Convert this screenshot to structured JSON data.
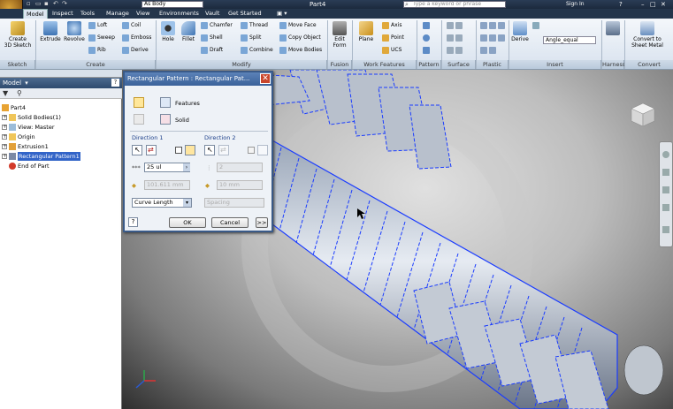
{
  "title_bar": {
    "document": "Part4",
    "combo_body": "As Body",
    "search_placeholder": "Type a keyword or phrase",
    "sign_in": "Sign In"
  },
  "tabs": [
    "Model",
    "Inspect",
    "Tools",
    "Manage",
    "View",
    "Environments",
    "Vault",
    "Get Started"
  ],
  "active_tab": "Model",
  "ribbon": {
    "sketch": {
      "create_label": "Create\n3D Sketch",
      "panel": "Sketch"
    },
    "create": {
      "extrude": "Extrude",
      "revolve": "Revolve",
      "loft": "Loft",
      "sweep": "Sweep",
      "rib": "Rib",
      "coil": "Coil",
      "emboss": "Emboss",
      "derive": "Derive",
      "panel": "Create"
    },
    "modify": {
      "hole": "Hole",
      "fillet": "Fillet",
      "chamfer": "Chamfer",
      "shell": "Shell",
      "draft": "Draft",
      "thread": "Thread",
      "split": "Split",
      "combine": "Combine",
      "move_face": "Move Face",
      "copy_object": "Copy Object",
      "move_bodies": "Move Bodies",
      "panel": "Modify"
    },
    "fusion": {
      "edit_form": "Edit\nForm",
      "panel": "Fusion"
    },
    "work_features": {
      "plane": "Plane",
      "axis": "Axis",
      "point": "Point",
      "ucs": "UCS",
      "panel": "Work Features"
    },
    "pattern": {
      "panel": "Pattern"
    },
    "surface": {
      "panel": "Surface"
    },
    "plastic_part": {
      "panel": "Plastic Part"
    },
    "insert": {
      "derive": "Derive",
      "param": "Angle_equal",
      "panel": "Insert"
    },
    "harness": {
      "panel": "Harness"
    },
    "convert": {
      "label": "Convert to\nSheet Metal",
      "panel": "Convert"
    }
  },
  "browser": {
    "title": "Model",
    "items": [
      {
        "label": "Part4",
        "level": 0
      },
      {
        "label": "Solid Bodies(1)",
        "level": 1
      },
      {
        "label": "View: Master",
        "level": 1
      },
      {
        "label": "Origin",
        "level": 1
      },
      {
        "label": "Extrusion1",
        "level": 1
      },
      {
        "label": "Rectangular Pattern1",
        "level": 1,
        "selected": true
      },
      {
        "label": "End of Part",
        "level": 1
      }
    ]
  },
  "dialog": {
    "title": "Rectangular Pattern : Rectangular Pat...",
    "features_label": "Features",
    "solid_label": "Solid",
    "direction1": {
      "label": "Direction 1",
      "count": "25 ul",
      "length": "101.611 mm",
      "method": "Curve Length"
    },
    "direction2": {
      "label": "Direction 2",
      "count": "2",
      "length": "10 mm",
      "method": "Spacing"
    },
    "ok": "OK",
    "cancel": "Cancel",
    "more": ">>"
  },
  "colors": {
    "accent": "#3b629a",
    "edge_highlight": "#1a3cff"
  }
}
